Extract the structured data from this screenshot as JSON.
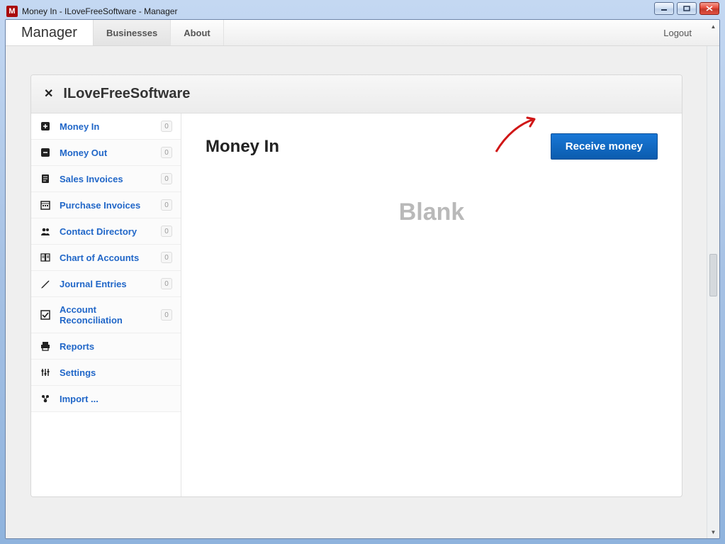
{
  "window": {
    "title": "Money In - ILoveFreeSoftware - Manager",
    "app_icon_letter": "M"
  },
  "appbar": {
    "brand": "Manager",
    "tab_businesses": "Businesses",
    "tab_about": "About",
    "logout": "Logout"
  },
  "panel": {
    "title": "ILoveFreeSoftware"
  },
  "sidebar": {
    "items": [
      {
        "label": "Money In",
        "count": "0",
        "icon": "plus-box-icon"
      },
      {
        "label": "Money Out",
        "count": "0",
        "icon": "minus-box-icon"
      },
      {
        "label": "Sales Invoices",
        "count": "0",
        "icon": "receipt-icon"
      },
      {
        "label": "Purchase Invoices",
        "count": "0",
        "icon": "calendar-icon"
      },
      {
        "label": "Contact Directory",
        "count": "0",
        "icon": "people-icon"
      },
      {
        "label": "Chart of Accounts",
        "count": "0",
        "icon": "book-icon"
      },
      {
        "label": "Journal Entries",
        "count": "0",
        "icon": "pen-icon"
      },
      {
        "label": "Account Reconciliation",
        "count": "0",
        "icon": "check-box-icon"
      },
      {
        "label": "Reports",
        "count": null,
        "icon": "printer-icon"
      },
      {
        "label": "Settings",
        "count": null,
        "icon": "sliders-icon"
      },
      {
        "label": "Import ...",
        "count": null,
        "icon": "import-icon"
      }
    ]
  },
  "main": {
    "title": "Money In",
    "primary_button": "Receive money",
    "watermark": "Blank"
  }
}
